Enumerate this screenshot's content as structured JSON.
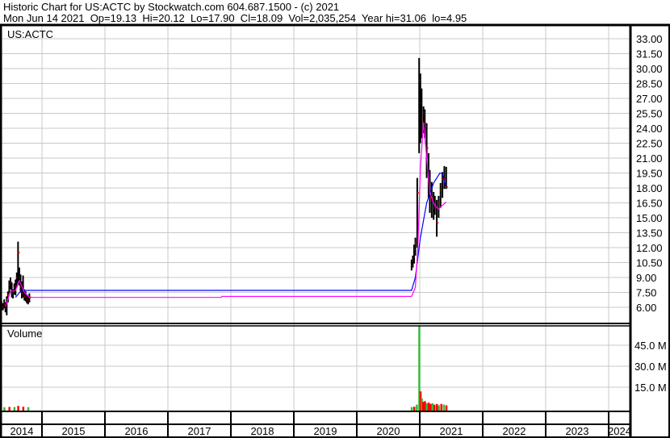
{
  "header": {
    "title": "Historic Chart for US:ACTC by Stockwatch.com 604.687.1500 - (c) 2021",
    "quote": "Mon Jun 14 2021  Op=19.13  Hi=20.12  Lo=17.90  Cl=18.09  Vol=2,035,254  Year hi=31.06  lo=4.95"
  },
  "chart_data": [
    {
      "type": "bar",
      "title": "US:ACTC",
      "subtype": "ohlc",
      "ylim": [
        4.9,
        34.2
      ],
      "yticks": [
        "33.00",
        "31.50",
        "30.00",
        "28.50",
        "27.00",
        "25.50",
        "24.00",
        "22.50",
        "21.00",
        "19.50",
        "18.00",
        "16.50",
        "15.00",
        "13.50",
        "12.00",
        "10.50",
        "9.00",
        "7.50",
        "6.00"
      ],
      "xticks": [
        "2014",
        "2015",
        "2016",
        "2017",
        "2018",
        "2019",
        "2020",
        "2021",
        "2022",
        "2023",
        "2024"
      ],
      "colors": {
        "bar": "#000000",
        "close": "#ff0000",
        "ma_short": "#ff00ff",
        "ma_long": "#0000ff",
        "grid": "#c8c8c8",
        "volume_up": "#33bb33",
        "volume_down": "#ff0000"
      },
      "bars": [
        [
          2014.36,
          6.6,
          5.8,
          6.1
        ],
        [
          2014.38,
          6.4,
          5.7,
          6.0
        ],
        [
          2014.4,
          6.8,
          5.9,
          6.3
        ],
        [
          2014.42,
          6.5,
          5.5,
          5.9
        ],
        [
          2014.44,
          7.1,
          5.2,
          6.8
        ],
        [
          2014.46,
          7.6,
          6.5,
          7.2
        ],
        [
          2014.48,
          8.7,
          7.4,
          8.3
        ],
        [
          2014.5,
          9.0,
          7.8,
          8.5
        ],
        [
          2014.52,
          8.5,
          7.0,
          7.4
        ],
        [
          2014.54,
          7.8,
          6.9,
          7.5
        ],
        [
          2014.56,
          8.4,
          7.3,
          8.0
        ],
        [
          2014.58,
          8.8,
          7.2,
          8.1
        ],
        [
          2014.6,
          9.5,
          8.0,
          9.0
        ],
        [
          2014.62,
          12.6,
          8.5,
          11.5
        ],
        [
          2014.64,
          10.0,
          8.2,
          9.0
        ],
        [
          2014.66,
          9.3,
          7.5,
          8.0
        ],
        [
          2014.68,
          8.6,
          6.9,
          7.4
        ],
        [
          2014.7,
          9.2,
          7.0,
          7.6
        ],
        [
          2014.72,
          7.8,
          6.7,
          7.1
        ],
        [
          2014.74,
          7.6,
          6.6,
          7.0
        ],
        [
          2014.76,
          7.3,
          6.4,
          6.8
        ],
        [
          2014.78,
          7.1,
          6.3,
          6.7
        ],
        [
          2014.8,
          7.4,
          6.5,
          7.0
        ]
      ],
      "bars2": [
        [
          2020.87,
          10.8,
          9.7,
          10.2
        ],
        [
          2020.89,
          11.2,
          10.0,
          10.7
        ],
        [
          2020.91,
          12.3,
          10.4,
          11.8
        ],
        [
          2020.93,
          13.0,
          11.2,
          12.5
        ],
        [
          2020.96,
          19.0,
          12.0,
          17.5
        ],
        [
          2020.99,
          31.06,
          21.5,
          28.8
        ],
        [
          2021.01,
          29.5,
          22.5,
          26.5
        ],
        [
          2021.03,
          28.0,
          23.0,
          25.0
        ],
        [
          2021.06,
          26.2,
          23.5,
          25.5
        ],
        [
          2021.08,
          25.9,
          23.0,
          24.5
        ],
        [
          2021.11,
          24.5,
          19.0,
          22.0
        ],
        [
          2021.14,
          21.5,
          17.0,
          18.5
        ],
        [
          2021.16,
          19.8,
          15.5,
          17.0
        ],
        [
          2021.19,
          18.6,
          15.0,
          16.8
        ],
        [
          2021.22,
          17.6,
          14.8,
          16.0
        ],
        [
          2021.24,
          17.2,
          15.3,
          16.4
        ],
        [
          2021.27,
          16.8,
          13.1,
          14.5
        ],
        [
          2021.3,
          17.2,
          15.0,
          16.5
        ],
        [
          2021.33,
          18.5,
          16.0,
          17.8
        ],
        [
          2021.36,
          19.6,
          17.0,
          18.9
        ],
        [
          2021.39,
          20.2,
          17.9,
          19.0
        ],
        [
          2021.42,
          20.12,
          17.9,
          18.09
        ]
      ],
      "ma_short": [
        [
          2014.42,
          6.1
        ],
        [
          2014.5,
          7.6
        ],
        [
          2014.58,
          7.7
        ],
        [
          2014.64,
          8.7
        ],
        [
          2014.72,
          7.5
        ],
        [
          2014.8,
          7.0
        ],
        [
          2017.85,
          7.0
        ],
        [
          2017.86,
          7.1
        ],
        [
          2020.87,
          7.1
        ],
        [
          2020.93,
          8.0
        ],
        [
          2020.97,
          12
        ],
        [
          2021.01,
          20
        ],
        [
          2021.06,
          24.6
        ],
        [
          2021.11,
          21
        ],
        [
          2021.16,
          17.5
        ],
        [
          2021.24,
          16.2
        ],
        [
          2021.3,
          15.9
        ],
        [
          2021.42,
          16.6
        ]
      ],
      "ma_long": [
        [
          2014.58,
          7.0
        ],
        [
          2014.66,
          7.6
        ],
        [
          2014.72,
          7.7
        ],
        [
          2020.87,
          7.7
        ],
        [
          2020.93,
          9.0
        ],
        [
          2021.01,
          13
        ],
        [
          2021.11,
          16.5
        ],
        [
          2021.22,
          18.5
        ],
        [
          2021.32,
          19.5
        ],
        [
          2021.36,
          19.4
        ],
        [
          2021.42,
          18.0
        ]
      ]
    },
    {
      "type": "bar",
      "title": "Volume",
      "ylim": [
        0,
        59
      ],
      "yticks": [
        "45.0 M",
        "30.0 M",
        "15.0 M"
      ],
      "ytick_values": [
        45,
        30,
        15
      ],
      "volume": [
        [
          2014.4,
          0.6,
          1
        ],
        [
          2014.48,
          0.9,
          0
        ],
        [
          2014.56,
          0.8,
          1
        ],
        [
          2014.62,
          1.6,
          0
        ],
        [
          2014.7,
          1.0,
          0
        ],
        [
          2014.78,
          0.7,
          1
        ],
        [
          2020.87,
          0.8,
          1
        ],
        [
          2020.91,
          1.0,
          0
        ],
        [
          2020.95,
          2.5,
          1
        ],
        [
          2020.99,
          59,
          1
        ],
        [
          2021.01,
          12,
          0
        ],
        [
          2021.03,
          7,
          1
        ],
        [
          2021.05,
          4.5,
          0
        ],
        [
          2021.08,
          5,
          0
        ],
        [
          2021.11,
          3.5,
          1
        ],
        [
          2021.14,
          4,
          0
        ],
        [
          2021.17,
          3,
          0
        ],
        [
          2021.2,
          3.5,
          1
        ],
        [
          2021.23,
          2.5,
          0
        ],
        [
          2021.27,
          3,
          0
        ],
        [
          2021.3,
          2,
          1
        ],
        [
          2021.34,
          3,
          0
        ],
        [
          2021.38,
          2.5,
          1
        ],
        [
          2021.42,
          2.0,
          0
        ]
      ]
    }
  ]
}
